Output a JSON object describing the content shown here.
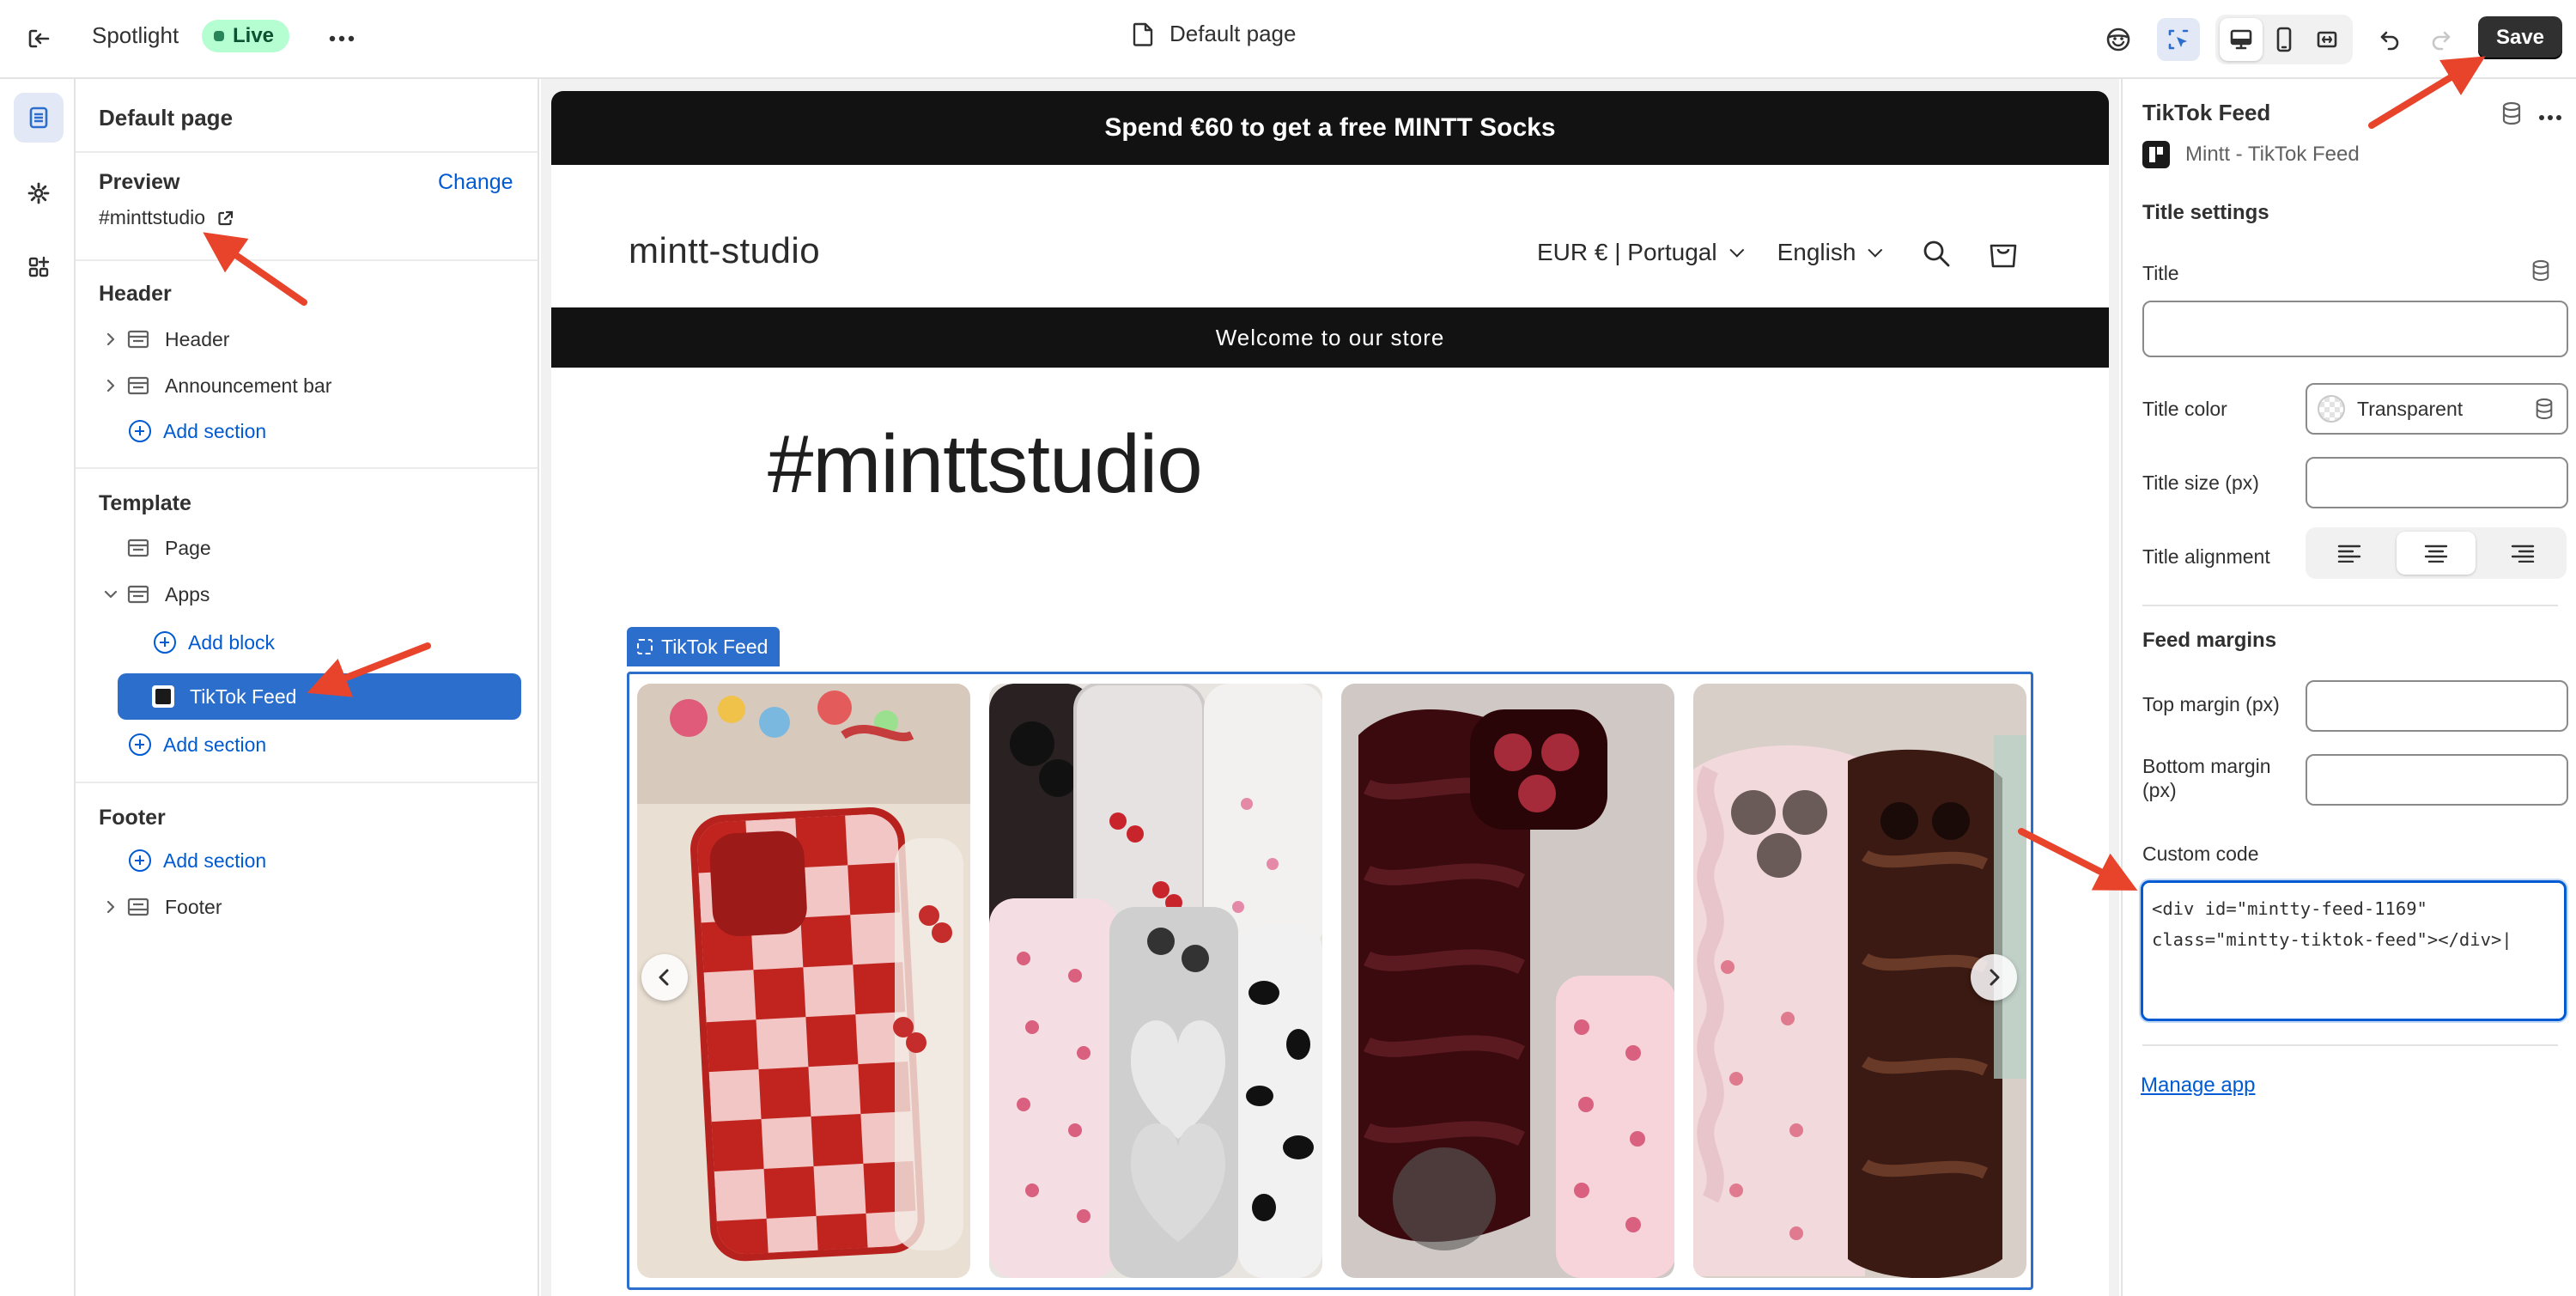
{
  "topbar": {
    "theme_name": "Spotlight",
    "live_badge": "Live",
    "page_title": "Default page",
    "save_label": "Save"
  },
  "sidebar": {
    "title": "Default page",
    "preview_heading": "Preview",
    "change_link": "Change",
    "preview_value": "#minttstudio",
    "header_heading": "Header",
    "header_items": [
      "Header",
      "Announcement bar"
    ],
    "add_section": "Add section",
    "template_heading": "Template",
    "template_items": [
      "Page",
      "Apps"
    ],
    "add_block": "Add block",
    "selected_block": "TikTok Feed",
    "footer_heading": "Footer",
    "footer_items": [
      "Footer"
    ]
  },
  "preview": {
    "promo_text": "Spend €60 to get a free MINTT Socks",
    "store_logo": "mintt-studio",
    "currency": "EUR € | Portugal",
    "language": "English",
    "welcome_text": "Welcome to our store",
    "hashtag": "#minttstudio",
    "block_label": "TikTok Feed"
  },
  "settings": {
    "title": "TikTok Feed",
    "app_name": "Mintt - TikTok Feed",
    "title_settings_heading": "Title settings",
    "title_label": "Title",
    "title_value": "",
    "title_color_label": "Title color",
    "title_color_value": "Transparent",
    "title_size_label": "Title size (px)",
    "title_alignment_label": "Title alignment",
    "title_alignment_selected": "center",
    "feed_margins_heading": "Feed margins",
    "top_margin_label": "Top margin (px)",
    "bottom_margin_label": "Bottom margin (px)",
    "custom_code_label": "Custom code",
    "custom_code_value": "<div id=\"mintty-feed-1169\"\nclass=\"mintty-tiktok-feed\"></div>|",
    "manage_app_link": "Manage app"
  },
  "colors": {
    "accent_blue": "#2c6ecb",
    "link_blue": "#005bd3",
    "annotation_red": "#e8442b",
    "promo_bg": "#121212"
  }
}
